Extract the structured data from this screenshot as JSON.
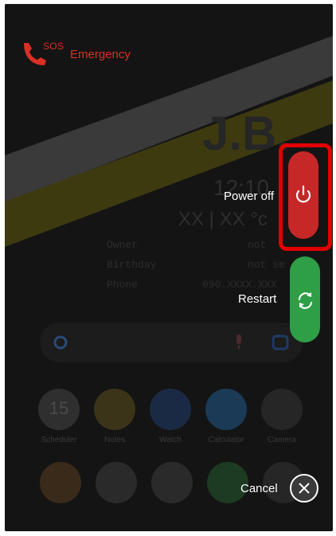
{
  "emergency": {
    "sos_badge": "SOS",
    "label": "Emergency"
  },
  "power_menu": {
    "power_off_label": "Power off",
    "restart_label": "Restart",
    "cancel_label": "Cancel"
  },
  "lockscreen": {
    "initials": "J.B.",
    "time": "12:10",
    "weather": "XX | XX °c",
    "info_rows": [
      {
        "key": "Owner",
        "value": "not"
      },
      {
        "key": "Birthday",
        "value": "not se"
      },
      {
        "key": "Phone",
        "value": "090.XXXX.XXX"
      }
    ]
  },
  "apps": [
    {
      "label": "Scheduler",
      "icon": "calendar-icon",
      "day": "15"
    },
    {
      "label": "Notes",
      "icon": "notes-icon"
    },
    {
      "label": "Watch",
      "icon": "clock-icon"
    },
    {
      "label": "Calculator",
      "icon": "calculator-icon"
    },
    {
      "label": "Camera",
      "icon": "camera-icon"
    }
  ],
  "dock": [
    {
      "icon": "chrome-icon"
    },
    {
      "icon": "play-store-icon"
    },
    {
      "icon": "google-folder-icon"
    },
    {
      "icon": "phone-icon"
    },
    {
      "icon": "settings-icon"
    }
  ],
  "colors": {
    "power_red": "#c62828",
    "restart_green": "#2e9e47",
    "emergency_red": "#d93025",
    "highlight": "#e00000"
  }
}
